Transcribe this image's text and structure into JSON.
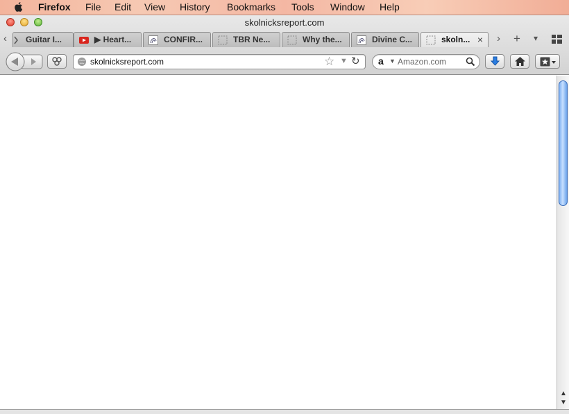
{
  "menubar": {
    "app_name": "Firefox",
    "items": [
      "File",
      "Edit",
      "View",
      "History",
      "Bookmarks",
      "Tools",
      "Window",
      "Help"
    ]
  },
  "window": {
    "title": "skolnicksreport.com"
  },
  "tabs": [
    {
      "label": "Guitar I...",
      "favicon": "guitar-page-icon",
      "active": false
    },
    {
      "label": "▶ Heart...",
      "favicon": "youtube-icon",
      "active": false
    },
    {
      "label": "CONFIR...",
      "favicon": "generic-site-icon",
      "active": false
    },
    {
      "label": "TBR Ne...",
      "favicon": "blank-page-icon",
      "active": false
    },
    {
      "label": "Why the...",
      "favicon": "blank-page-icon",
      "active": false
    },
    {
      "label": "Divine C...",
      "favicon": "generic-site-icon",
      "active": false
    },
    {
      "label": "skoln...",
      "favicon": "blank-page-icon",
      "active": true,
      "close": "×"
    }
  ],
  "tabstrip": {
    "new_tab": "+",
    "scroll_left": "‹",
    "scroll_right": "›",
    "list_tabs": "▾"
  },
  "navbar": {
    "url": "skolnicksreport.com",
    "search_placeholder": "Amazon.com",
    "search_engine_logo": "a"
  },
  "colors": {
    "accent_blue": "#2a7de1",
    "scroll_thumb": "#7fb2f2",
    "close_red": "#e0392b",
    "minimize_yellow": "#e5a82c",
    "zoom_green": "#5fb43a"
  }
}
